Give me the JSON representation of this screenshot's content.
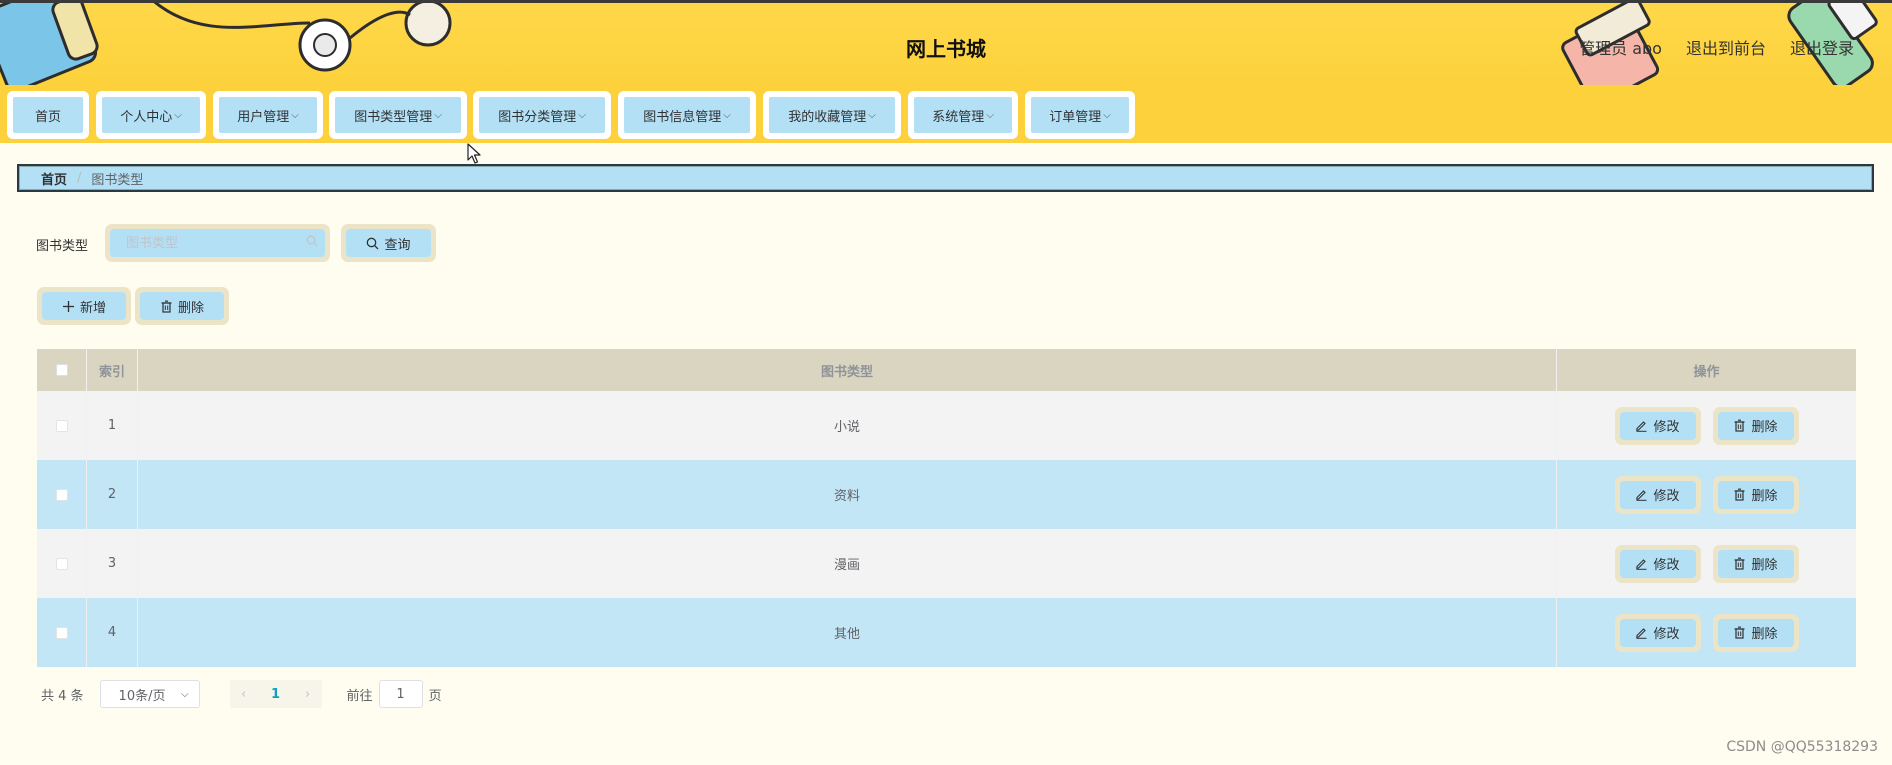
{
  "header": {
    "title": "网上书城",
    "admin_label": "管理员 abo",
    "to_front_label": "退出到前台",
    "logout_label": "退出登录"
  },
  "nav": [
    {
      "label": "首页",
      "dropdown": false
    },
    {
      "label": "个人中心",
      "dropdown": true
    },
    {
      "label": "用户管理",
      "dropdown": true
    },
    {
      "label": "图书类型管理",
      "dropdown": true
    },
    {
      "label": "图书分类管理",
      "dropdown": true
    },
    {
      "label": "图书信息管理",
      "dropdown": true
    },
    {
      "label": "我的收藏管理",
      "dropdown": true
    },
    {
      "label": "系统管理",
      "dropdown": true
    },
    {
      "label": "订单管理",
      "dropdown": true
    }
  ],
  "breadcrumb": {
    "home": "首页",
    "separator": "/",
    "current": "图书类型"
  },
  "search": {
    "label": "图书类型",
    "placeholder": "图书类型",
    "query_label": "查询"
  },
  "actions": {
    "add_label": "新增",
    "delete_label": "删除"
  },
  "table": {
    "headers": {
      "index": "索引",
      "type": "图书类型",
      "ops": "操作"
    },
    "rows": [
      {
        "index": "1",
        "type": "小说"
      },
      {
        "index": "2",
        "type": "资料"
      },
      {
        "index": "3",
        "type": "漫画"
      },
      {
        "index": "4",
        "type": "其他"
      }
    ],
    "edit_label": "修改",
    "delete_label": "删除"
  },
  "pagination": {
    "total": "共 4 条",
    "page_size": "10条/页",
    "current_page": "1",
    "goto_label": "前往",
    "goto_value": "1",
    "page_suffix": "页"
  },
  "watermark": "CSDN @QQ55318293",
  "colors": {
    "header_bg": "#fcd13b",
    "button_bg": "#b3e0f5",
    "button_border": "#ebe4c7",
    "row_alt": "#c3e6f7",
    "page_bg": "#fffdf0"
  }
}
